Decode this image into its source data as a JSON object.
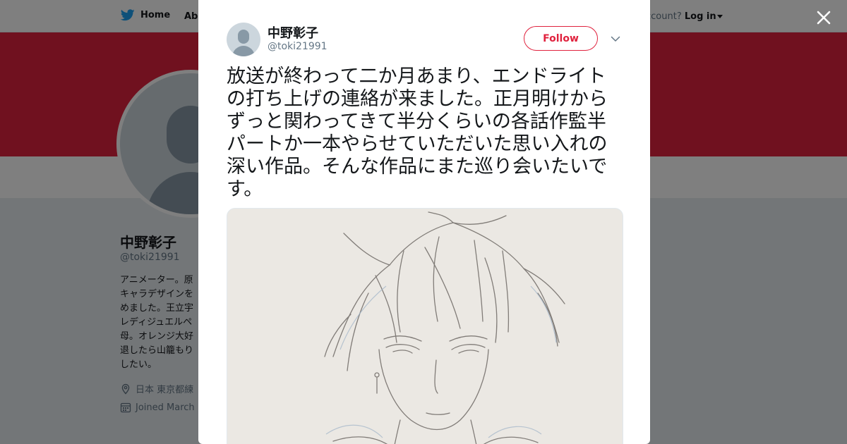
{
  "topbar": {
    "home_label": "Home",
    "about_label": "Abo",
    "account_prompt": "ccount?",
    "login_label": "Log in"
  },
  "profile": {
    "name": "中野彰子",
    "handle": "@toki21991",
    "bio": "アニメーター。原\nキャラデザインを\nめました。王立宇\nレディジュエルペ\n母。オレンジ大好\n退したら山籠もり\nしたい。",
    "location": "日本 東京都練",
    "joined": "Joined March"
  },
  "tweet": {
    "author_name": "中野彰子",
    "author_handle": "@toki21991",
    "follow_label": "Follow",
    "text": "放送が終わって二か月あまり、エンドライトの打ち上げの連絡が来ました。正月明けからずっと関わってきて半分くらいの各話作監半パートか一本やらせていただいた思い入れの深い作品。そんな作品にまた巡り会いたいです。"
  },
  "icons": {
    "logo": "twitter-bird-icon",
    "close": "close-icon",
    "menu": "chevron-down-icon",
    "location": "location-pin-icon",
    "calendar": "calendar-icon"
  },
  "colors": {
    "brand": "#1da1f2",
    "accent": "#e0223e",
    "text": "#14171a",
    "secondary_text": "#657786",
    "overlay": "rgba(0,0,0,0.5)"
  }
}
